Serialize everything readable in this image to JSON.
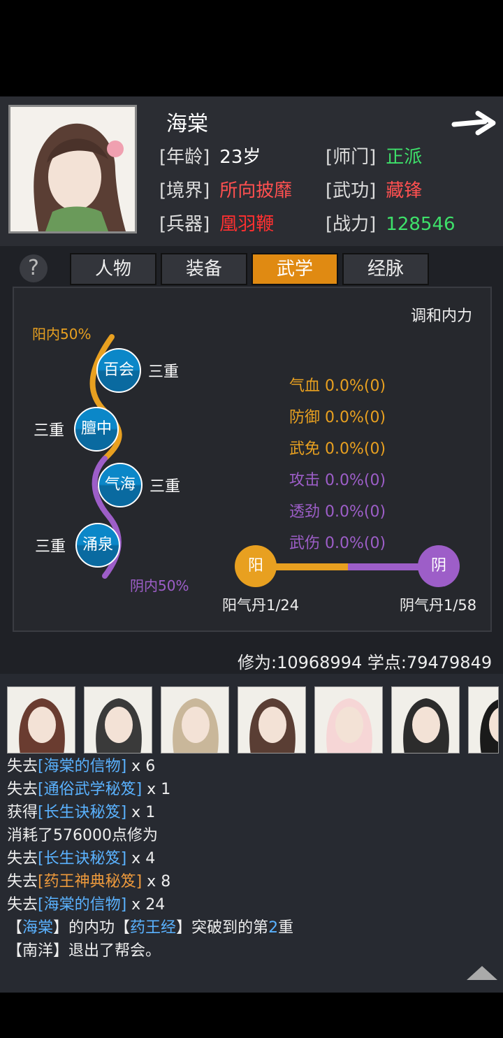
{
  "character": {
    "name": "海棠",
    "fields": [
      {
        "label": "[年龄]",
        "value": "23岁",
        "color": "#ffffff"
      },
      {
        "label": "[师门]",
        "value": "正派",
        "color": "#3ee06a"
      },
      {
        "label": "[境界]",
        "value": "所向披靡",
        "color": "#ff5050"
      },
      {
        "label": "[武功]",
        "value": "藏锋",
        "color": "#ff5050"
      },
      {
        "label": "[兵器]",
        "value": "凰羽鞭",
        "color": "#ff3030"
      },
      {
        "label": "[战力]",
        "value": "128546",
        "color": "#3ee06a"
      }
    ]
  },
  "help_icon": "?",
  "tabs": [
    {
      "label": "人物",
      "active": false
    },
    {
      "label": "装备",
      "active": false
    },
    {
      "label": "武学",
      "active": true
    },
    {
      "label": "经脉",
      "active": false
    }
  ],
  "meridian": {
    "reconcile_label": "调和内力",
    "yang_label": "阳内50%",
    "yin_label": "阴内50%",
    "nodes": [
      {
        "name": "百会",
        "level": "三重"
      },
      {
        "name": "膻中",
        "level": "三重"
      },
      {
        "name": "气海",
        "level": "三重"
      },
      {
        "name": "涌泉",
        "level": "三重"
      }
    ],
    "stats": [
      {
        "text": "气血 0.0%(0)",
        "type": "yang"
      },
      {
        "text": "防御 0.0%(0)",
        "type": "yang"
      },
      {
        "text": "武免 0.0%(0)",
        "type": "yang"
      },
      {
        "text": "攻击 0.0%(0)",
        "type": "yin"
      },
      {
        "text": "透劲 0.0%(0)",
        "type": "yin"
      },
      {
        "text": "武伤 0.0%(0)",
        "type": "yin"
      }
    ],
    "yang_pill": {
      "icon": "阳",
      "label": "阳气丹1/24"
    },
    "yin_pill": {
      "icon": "阴",
      "label": "阴气丹1/58"
    },
    "colors": {
      "yang": "#e8a020",
      "yin": "#9d5ec8"
    }
  },
  "cultivation": "修为:10968994 学点:79479849",
  "log": [
    [
      {
        "t": "失去"
      },
      {
        "t": "[海棠的信物]",
        "c": "blue"
      },
      {
        "t": " x 6"
      }
    ],
    [
      {
        "t": "失去"
      },
      {
        "t": "[通俗武学秘笈]",
        "c": "blue"
      },
      {
        "t": " x 1"
      }
    ],
    [
      {
        "t": "获得"
      },
      {
        "t": "[长生诀秘笈]",
        "c": "blue"
      },
      {
        "t": " x 1"
      }
    ],
    [
      {
        "t": "消耗了576000点修为"
      }
    ],
    [
      {
        "t": "失去"
      },
      {
        "t": "[长生诀秘笈]",
        "c": "blue"
      },
      {
        "t": " x 4"
      }
    ],
    [
      {
        "t": "失去"
      },
      {
        "t": "[药王神典秘笈]",
        "c": "orange"
      },
      {
        "t": " x 8"
      }
    ],
    [
      {
        "t": "失去"
      },
      {
        "t": "[海棠的信物]",
        "c": "blue"
      },
      {
        "t": " x 24"
      }
    ],
    [
      {
        "t": "【"
      },
      {
        "t": "海棠",
        "c": "blue"
      },
      {
        "t": "】的内功【"
      },
      {
        "t": "药王经",
        "c": "blue"
      },
      {
        "t": "】突破到的第"
      },
      {
        "t": "2",
        "c": "blue"
      },
      {
        "t": "重"
      }
    ],
    [
      {
        "t": "【南洋】退出了帮会。"
      }
    ]
  ]
}
